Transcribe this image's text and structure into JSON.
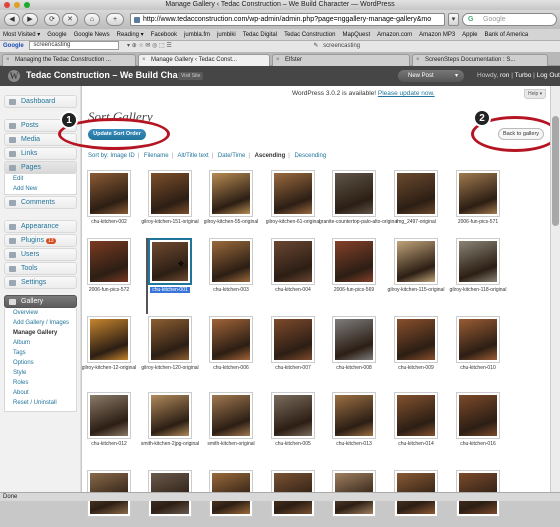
{
  "window": {
    "title": "Manage Gallery ‹ Tedac Construction – We Build Character — WordPress"
  },
  "nav": {
    "url": "http://www.tedacconstruction.com/wp-admin/admin.php?page=nggallery-manage-gallery&mo",
    "search_placeholder": "Google"
  },
  "bookmarks": [
    "Most Visited ▾",
    "Google",
    "Google News",
    "Reading ▾",
    "Facebook",
    "jumbla.fm",
    "jumbiki",
    "Tedac Digital",
    "Tedac Construction",
    "MapQuest",
    "Amazon.com",
    "Amazon MP3",
    "Apple",
    "Bank of America"
  ],
  "google_toolbar": {
    "query": "screencasting",
    "highlight": "screencasting"
  },
  "tabs": [
    {
      "label": "Managing the Tedac Construction ..."
    },
    {
      "label": "Manage Gallery ‹ Tedac Const..."
    },
    {
      "label": "Elfster"
    },
    {
      "label": "ScreenSteps Documentation : S..."
    }
  ],
  "wp": {
    "site_title": "Tedac Construction – We Build Charac...",
    "visit_site": "Visit Site",
    "new_post": "New Post",
    "howdy": "Howdy,",
    "user": "ron",
    "turbo": "Turbo",
    "logout": "Log Out"
  },
  "sidebar": {
    "dashboard": "Dashboard",
    "posts": "Posts",
    "media": "Media",
    "links": "Links",
    "pages": "Pages",
    "pages_sub": [
      "Edit",
      "Add New"
    ],
    "comments": "Comments",
    "appearance": "Appearance",
    "plugins": "Plugins",
    "plugins_badge": "13",
    "users": "Users",
    "tools": "Tools",
    "settings": "Settings",
    "gallery": "Gallery",
    "gallery_sub": [
      "Overview",
      "Add Gallery / Images",
      "Manage Gallery",
      "Album",
      "Tags",
      "Options",
      "Style",
      "Roles",
      "About",
      "Reset / Uninstall"
    ]
  },
  "main": {
    "notice_text": "WordPress 3.0.2 is available!",
    "notice_link": "Please update now.",
    "help": "Help ▾",
    "page_title": "Sort Gallery",
    "update_button": "Update Sort Order",
    "back_button": "Back to gallery",
    "callout1": "1",
    "callout2": "2",
    "sort_by_prefix": "Sort by: Image ID",
    "sort_filename": "Filename",
    "sort_alt": "Alt/Title text",
    "sort_date": "Date/Time",
    "sort_asc": "Ascending",
    "sort_desc": "Descending",
    "sep": "|"
  },
  "thumbnails": [
    {
      "caption": "chu-kitchen-002",
      "color": "#8a5b34"
    },
    {
      "caption": "gilroy-kitchen-151-original",
      "color": "#7b4f2b"
    },
    {
      "caption": "gilroy-kitchen-55-original",
      "color": "#b78b52"
    },
    {
      "caption": "gilroy-kitchen-61-original",
      "color": "#9a6a3f"
    },
    {
      "caption": "granite-countertop-palo-alto-original",
      "color": "#5e5548"
    },
    {
      "caption": "img_2497-original",
      "color": "#6b4a2e"
    },
    {
      "caption": "2006-fun-pics-571",
      "color": "#a07a4e"
    },
    {
      "caption": "2006-fun-pics-572",
      "color": "#7a3a22"
    },
    {
      "caption": "chu-kitchen-001",
      "color": "#6f4a30",
      "selected": true
    },
    {
      "caption": "chu-kitchen-003",
      "color": "#9b6a3c"
    },
    {
      "caption": "chu-kitchen-004",
      "color": "#6a4632"
    },
    {
      "caption": "2006-fun-pics-569",
      "color": "#85412a"
    },
    {
      "caption": "gilroy-kitchen-115-original",
      "color": "#c0a47a"
    },
    {
      "caption": "gilroy-kitchen-118-original",
      "color": "#8a8476"
    },
    {
      "caption": "gilroy-kitchen-12-original",
      "color": "#c6852e"
    },
    {
      "caption": "gilroy-kitchen-120-original",
      "color": "#8c5e32"
    },
    {
      "caption": "chu-kitchen-006",
      "color": "#a06438"
    },
    {
      "caption": "chu-kitchen-007",
      "color": "#7e4a2c"
    },
    {
      "caption": "chu-kitchen-008",
      "color": "#7d7d7c"
    },
    {
      "caption": "chu-kitchen-009",
      "color": "#8a4f2c"
    },
    {
      "caption": "chu-kitchen-010",
      "color": "#9a5c34"
    },
    {
      "caption": "chu-kitchen-012",
      "color": "#8a7a68"
    },
    {
      "caption": "smith-kitchen-2jpg-original",
      "color": "#b08a5a"
    },
    {
      "caption": "smith-kitchen-original",
      "color": "#a07850"
    },
    {
      "caption": "chu-kitchen-005",
      "color": "#7a6c5c"
    },
    {
      "caption": "chu-kitchen-013",
      "color": "#9c7044"
    },
    {
      "caption": "chu-kitchen-014",
      "color": "#83522e"
    },
    {
      "caption": "chu-kitchen-016",
      "color": "#7c4a2a"
    },
    {
      "caption": "",
      "color": "#8a6a4a"
    },
    {
      "caption": "",
      "color": "#6a5a4c"
    },
    {
      "caption": "",
      "color": "#9a6a3a"
    },
    {
      "caption": "",
      "color": "#7a5232"
    },
    {
      "caption": "",
      "color": "#a08060"
    },
    {
      "caption": "",
      "color": "#8a5a34"
    },
    {
      "caption": "",
      "color": "#7a4a2c"
    }
  ],
  "status": {
    "text": "Done"
  },
  "colors": {
    "accent": "#21759b",
    "callout_ring": "#b51522",
    "admin_bar": "#464646"
  }
}
